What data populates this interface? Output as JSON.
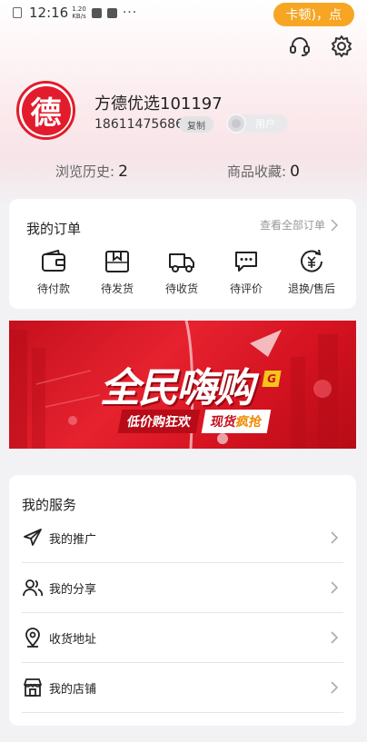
{
  "status_bar": {
    "time": "12:16",
    "speed_value": "1.20",
    "speed_unit": "KB/s",
    "overflow": "···",
    "toast": "卡顿)，点"
  },
  "header": {
    "icons": [
      "headset-icon",
      "settings-gear-icon"
    ]
  },
  "profile": {
    "avatar_char": "德",
    "name": "方德优选101197",
    "phone": "18611475686",
    "copy_label": "复制",
    "role": "用户",
    "history_label": "浏览历史:",
    "history_count": "2",
    "favorites_label": "商品收藏:",
    "favorites_count": "0"
  },
  "orders": {
    "title": "我的订单",
    "view_all": "查看全部订单",
    "items": [
      {
        "label": "待付款",
        "icon": "wallet-icon"
      },
      {
        "label": "待发货",
        "icon": "package-icon"
      },
      {
        "label": "待收货",
        "icon": "truck-icon"
      },
      {
        "label": "待评价",
        "icon": "comment-icon"
      },
      {
        "label": "退换/售后",
        "icon": "refund-icon"
      }
    ]
  },
  "banner": {
    "main": "全民嗨购",
    "badge": "G",
    "sub_left": "低价购狂欢",
    "sub_right_a": "现货",
    "sub_right_b": "疯抢",
    "accent_color": "#e6222f"
  },
  "services": {
    "title": "我的服务",
    "items": [
      {
        "label": "我的推广",
        "icon": "paper-plane-icon"
      },
      {
        "label": "我的分享",
        "icon": "users-icon"
      },
      {
        "label": "收货地址",
        "icon": "location-pin-icon"
      },
      {
        "label": "我的店铺",
        "icon": "store-icon"
      }
    ]
  }
}
